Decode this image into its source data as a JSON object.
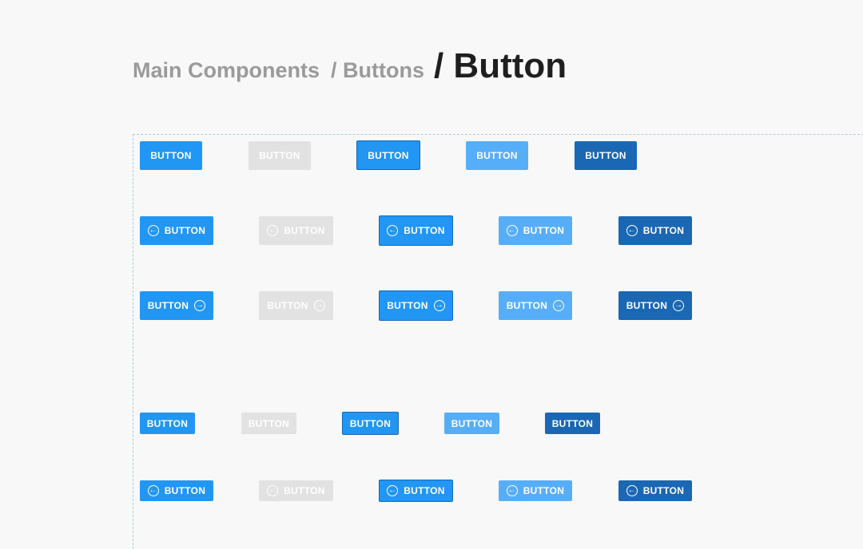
{
  "breadcrumb": {
    "level1": "Main Components",
    "level2": "/ Buttons",
    "current": "/ Button"
  },
  "rows": {
    "text_only": [
      "BUTTON",
      "BUTTON",
      "BUTTON",
      "BUTTON",
      "BUTTON"
    ],
    "icon_left": [
      "BUTTON",
      "BUTTON",
      "BUTTON",
      "BUTTON",
      "BUTTON"
    ],
    "icon_right": [
      "BUTTON",
      "BUTTON",
      "BUTTON",
      "BUTTON",
      "BUTTON"
    ],
    "small_text_only": [
      "BUTTON",
      "BUTTON",
      "BUTTON",
      "BUTTON",
      "BUTTON"
    ],
    "small_icon_left": [
      "BUTTON",
      "BUTTON",
      "BUTTON",
      "BUTTON",
      "BUTTON"
    ]
  },
  "icons": {
    "left": "arrow-circle-left-icon",
    "right": "arrow-circle-right-icon"
  },
  "colors": {
    "default": "#2196f3",
    "disabled": "#e2e2e2",
    "hover": "#57aef8",
    "pressed": "#1a67b3",
    "frame_border": "#9fd0d4"
  }
}
